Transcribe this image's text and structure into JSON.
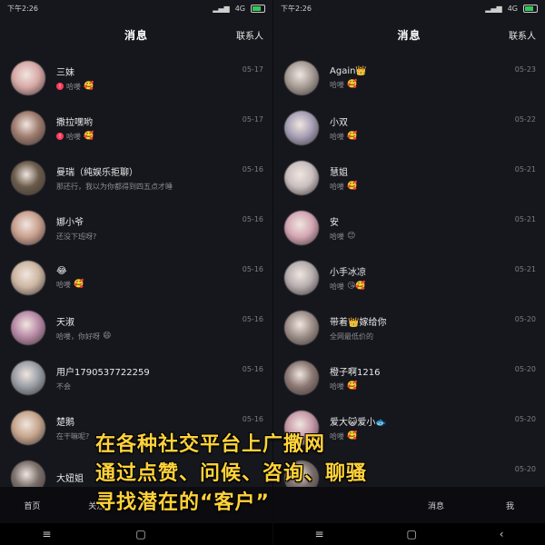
{
  "left": {
    "status": {
      "time": "下午2:26",
      "network": "4G"
    },
    "header": {
      "title": "消息",
      "contacts": "联系人"
    },
    "chats": [
      {
        "name": "三妹",
        "preview": "哈喽",
        "time": "05-17",
        "avatar": "#d7a9a6",
        "unread": true,
        "emoji": "🥰"
      },
      {
        "name": "撒拉嘿哟",
        "preview": "哈喽",
        "time": "05-17",
        "avatar": "#9e7b6d",
        "unread": true,
        "emoji": "🥰"
      },
      {
        "name": "曼瑞（纯娱乐拒聊）",
        "preview": "那还行，我以为你都得到四五点才睡",
        "time": "05-16",
        "avatar": "#6a5b4a",
        "unread": false,
        "emoji": ""
      },
      {
        "name": "娜小爷",
        "preview": "还没下班呀?",
        "time": "05-16",
        "avatar": "#c9a08e",
        "unread": false,
        "emoji": ""
      },
      {
        "name": "😂",
        "preview": "哈喽",
        "time": "05-16",
        "avatar": "#cdb6a2",
        "unread": false,
        "emoji": "🥰"
      },
      {
        "name": "天淑",
        "preview": "哈喽，你好呀",
        "time": "05-16",
        "avatar": "#b88aa7",
        "unread": false,
        "emoji": "😄"
      },
      {
        "name": "用户1790537722259",
        "preview": "不会",
        "time": "05-16",
        "avatar": "#9a9ea6",
        "unread": false,
        "emoji": ""
      },
      {
        "name": "楚鹅",
        "preview": "在干嘛呢?",
        "time": "05-16",
        "avatar": "#c6a58c",
        "unread": false,
        "emoji": ""
      },
      {
        "name": "大妞姐",
        "preview": "",
        "time": "",
        "avatar": "#7b6f6a",
        "unread": false,
        "emoji": ""
      }
    ],
    "nav": {
      "home": "首页",
      "follow": "关注"
    }
  },
  "right": {
    "status": {
      "time": "下午2:26",
      "network": "4G"
    },
    "header": {
      "title": "消息",
      "contacts": "联系人"
    },
    "chats": [
      {
        "name": "Again👑",
        "preview": "哈喽",
        "time": "05-23",
        "avatar": "#a79d96",
        "emoji": "🥰"
      },
      {
        "name": "小双",
        "preview": "哈喽",
        "time": "05-22",
        "avatar": "#a7a0b6",
        "emoji": "🥰"
      },
      {
        "name": "慧姐",
        "preview": "哈喽",
        "time": "05-21",
        "avatar": "#cabfbf",
        "emoji": "🥰"
      },
      {
        "name": "安",
        "preview": "哈喽",
        "time": "05-21",
        "avatar": "#d4a6b4",
        "emoji": "😊"
      },
      {
        "name": "小手冰凉",
        "preview": "哈喽",
        "time": "05-21",
        "avatar": "#b6aeae",
        "emoji": "😘🥰"
      },
      {
        "name": "带着👑嫁给你",
        "preview": "全网最低价的",
        "time": "05-20",
        "avatar": "#9d8f88",
        "emoji": ""
      },
      {
        "name": "橙子啊1216",
        "preview": "哈喽",
        "time": "05-20",
        "avatar": "#8c7873",
        "emoji": "🥰"
      },
      {
        "name": "爱大😺爱小🐟",
        "preview": "哈喽",
        "time": "05-20",
        "avatar": "#c79aa9",
        "emoji": "🥰"
      },
      {
        "name": "拌",
        "preview": "",
        "time": "05-20",
        "avatar": "#7a6e6a",
        "emoji": ""
      }
    ],
    "nav": {
      "messages": "消息",
      "me": "我"
    }
  },
  "overlay": {
    "line1": "在各种社交平台上广撒网",
    "line2": "通过点赞、问候、咨询、聊骚",
    "line3": "寻找潜在的“客户”"
  },
  "sysnav": {
    "menu": "≡",
    "home": "▢",
    "back": "‹"
  }
}
